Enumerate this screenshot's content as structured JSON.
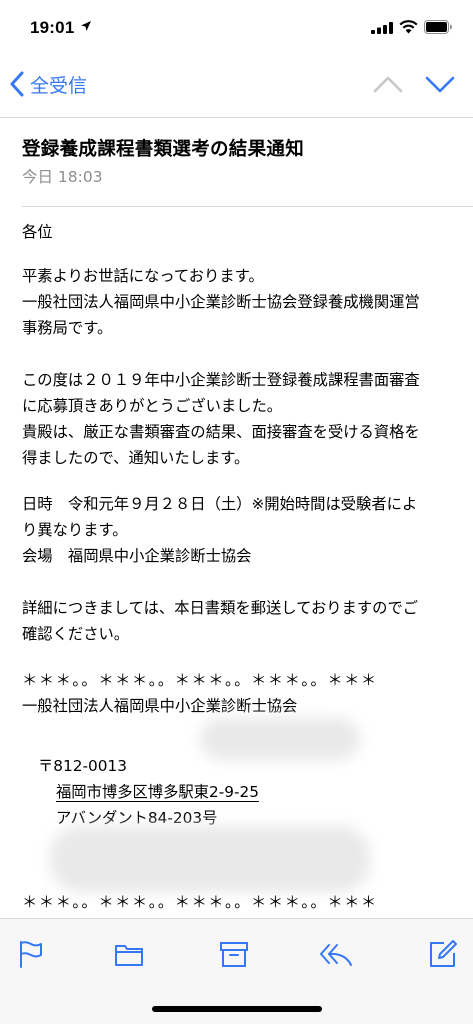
{
  "status_bar": {
    "time": "19:01"
  },
  "nav": {
    "back_label": "全受信"
  },
  "message": {
    "subject": "登録養成課程書類選考の結果通知",
    "date": "今日 18:03",
    "body": {
      "salutation": "各位",
      "p1": [
        "平素よりお世話になっております。",
        "一般社団法人福岡県中小企業診断士協会登録養成機関運営",
        "事務局です。"
      ],
      "p2": [
        "この度は２０１９年中小企業診断士登録養成課程書面審査",
        "に応募頂きありがとうございました。",
        "貴殿は、厳正な書類審査の結果、面接審査を受ける資格を",
        "得ましたので、通知いたします。"
      ],
      "p3": [
        "日時　令和元年９月２８日（土）※開始時間は受験者によ",
        "り異なります。",
        "会場　福岡県中小企業診断士協会"
      ],
      "p4": [
        "詳細につきましては、本日書類を郵送しておりますのでご",
        "確認ください。"
      ],
      "separator": "＊＊＊。。＊＊＊。。＊＊＊。。＊＊＊。。＊＊＊",
      "org": "一般社団法人福岡県中小企業診断士協会",
      "postal": "〒812-0013",
      "address1": "福岡市博多区博多駅東2-9-25",
      "address2": "アバンダント84-203号",
      "separator_bottom": "＊＊＊。。＊＊＊。。＊＊＊。。＊＊＊。。＊＊＊"
    }
  },
  "colors": {
    "accent": "#3478f6",
    "secondary_text": "#8e8e93",
    "divider": "#d8d8dc"
  },
  "toolbar": {
    "icons": [
      "flag-icon",
      "folder-icon",
      "archive-icon",
      "reply-icon",
      "compose-icon"
    ]
  }
}
